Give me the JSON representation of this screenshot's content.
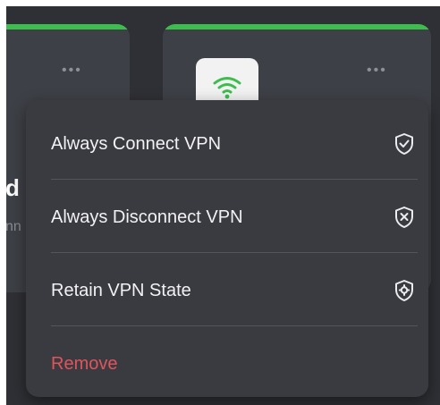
{
  "background_cards": {
    "left": {
      "title_fragment": "d",
      "subtitle_fragment": "nn",
      "more_icon": "ellipsis-icon"
    },
    "right": {
      "tile_icon": "wifi-icon",
      "more_icon": "ellipsis-icon"
    },
    "accent_color": "#3dbd4d"
  },
  "context_menu": {
    "items": [
      {
        "label": "Always Connect VPN",
        "icon": "shield-check-icon"
      },
      {
        "label": "Always Disconnect VPN",
        "icon": "shield-x-icon"
      },
      {
        "label": "Retain VPN State",
        "icon": "shield-gear-icon"
      },
      {
        "label": "Remove",
        "icon": "",
        "style": "danger",
        "color": "#e0545c"
      }
    ]
  }
}
